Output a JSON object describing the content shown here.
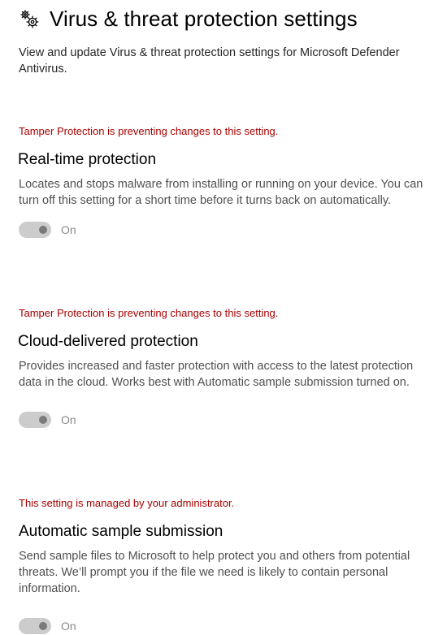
{
  "header": {
    "icon": "gear-cogs-icon",
    "title": "Virus & threat protection settings",
    "description": "View and update Virus & threat protection settings for Microsoft Defender Antivirus."
  },
  "sections": [
    {
      "warning": "Tamper Protection is preventing changes to this setting.",
      "title": "Real-time protection",
      "description": "Locates and stops malware from installing or running on your device. You can turn off this setting for a short time before it turns back on automatically.",
      "toggle_state": "On",
      "toggle_on": true,
      "toggle_disabled": true
    },
    {
      "warning": "Tamper Protection is preventing changes to this setting.",
      "title": "Cloud-delivered protection",
      "description": "Provides increased and faster protection with access to the latest protection data in the cloud. Works best with Automatic sample submission turned on.",
      "toggle_state": "On",
      "toggle_on": true,
      "toggle_disabled": true
    },
    {
      "warning": "This setting is managed by your administrator.",
      "title": "Automatic sample submission",
      "description": "Send sample files to Microsoft to help protect you and others from potential threats. We’ll prompt you if the file we need is likely to contain personal information.",
      "toggle_state": "On",
      "toggle_on": true,
      "toggle_disabled": true
    }
  ],
  "colors": {
    "warning": "#a80000",
    "toggle_disabled_track": "#cccccc",
    "toggle_disabled_knob": "#7a7a7a"
  }
}
